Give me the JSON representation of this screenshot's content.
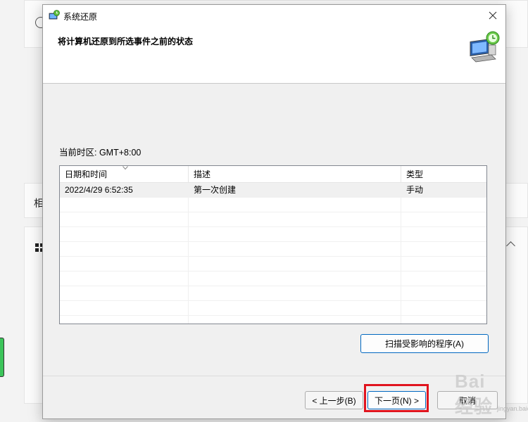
{
  "dialog": {
    "title": "系统还原",
    "heading": "将计算机还原到所选事件之前的状态",
    "timezone_label": "当前时区: GMT+8:00"
  },
  "table": {
    "columns": [
      "日期和时间",
      "描述",
      "类型"
    ],
    "rows": [
      {
        "datetime": "2022/4/29 6:52:35",
        "description": "第一次创建",
        "type": "手动"
      }
    ]
  },
  "buttons": {
    "scan": "扫描受影响的程序(A)",
    "back": "< 上一步(B)",
    "next": "下一页(N) >",
    "cancel": "取消"
  },
  "background": {
    "partial_label": "相"
  },
  "watermark": {
    "text": "Bai 经验",
    "sub": "jingyan.baidu.com"
  },
  "colors": {
    "highlight_box": "#e0141e",
    "accent_border": "#0067c0"
  },
  "icons": {
    "title": "system-restore-icon",
    "header": "computer-restore-icon",
    "close": "close-icon"
  }
}
